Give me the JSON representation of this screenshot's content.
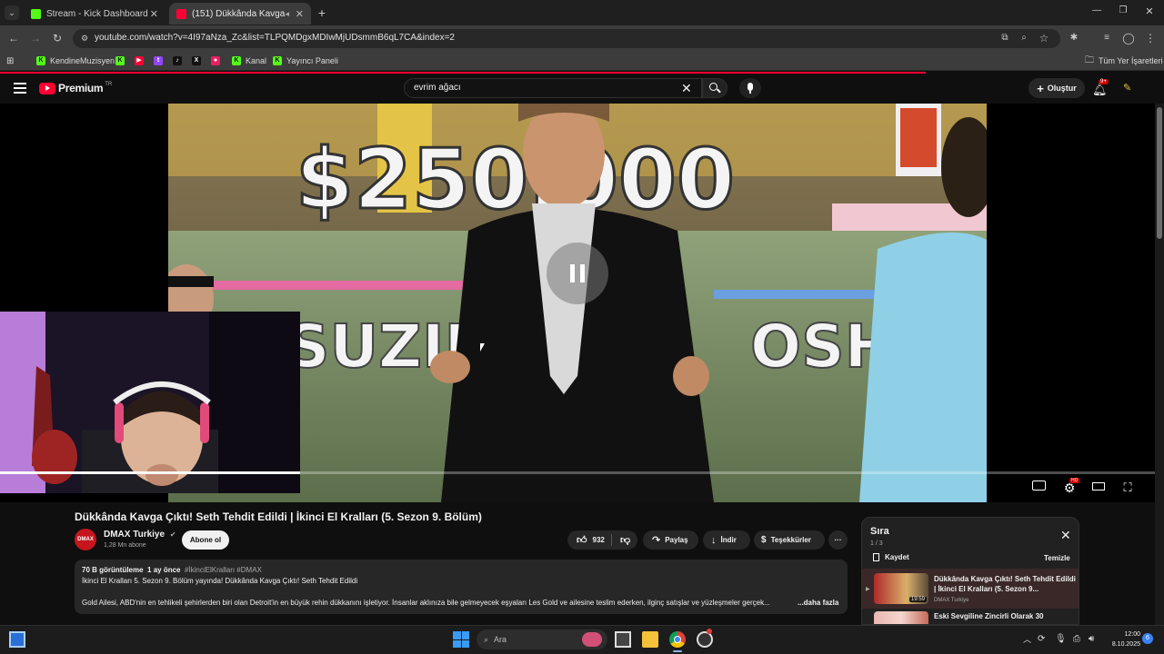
{
  "browser": {
    "tabs": [
      {
        "title": "Stream - Kick Dashboard",
        "favicon_color": "#53fc18"
      },
      {
        "title": "(151) Dükkânda Kavga Çıktı",
        "favicon_color": "#ff0033"
      }
    ],
    "url": "youtube.com/watch?v=4I97aNza_Zc&list=TLPQMDgxMDIwMjUDsmmB6qL7CA&index=2",
    "bookmarks": [
      {
        "label": "KendineMuzisyen",
        "color": "#53fc18",
        "glyph": "K"
      },
      {
        "label": "",
        "color": "#53fc18",
        "glyph": "K"
      },
      {
        "label": "",
        "color": "#ff0033",
        "glyph": "▶"
      },
      {
        "label": "",
        "color": "#9146ff",
        "glyph": "t"
      },
      {
        "label": "",
        "color": "#ffffff",
        "glyph": "♪"
      },
      {
        "label": "",
        "color": "#ffffff",
        "glyph": "X"
      },
      {
        "label": "",
        "color": "#e91e63",
        "glyph": "●"
      },
      {
        "label": "Kanal",
        "color": "#53fc18",
        "glyph": "K"
      },
      {
        "label": "Yayıncı Paneli",
        "color": "#53fc18",
        "glyph": "K"
      }
    ],
    "all_bookmarks_label": "Tüm Yer İşaretleri"
  },
  "yt": {
    "logo_text": "Premium",
    "logo_region": "TR",
    "search_query": "evrim ağacı",
    "create_label": "Oluştur",
    "notif_count": "9+"
  },
  "video": {
    "title": "Dükkânda Kavga Çıktı! Seth Tehdit Edildi | İkinci El Kralları (5. Sezon 9. Bölüm)",
    "overlay_prize": "$250,000",
    "overlay_name_left": "SUZIE",
    "overlay_name_right": "OSH",
    "channel_name": "DMAX Turkiye",
    "channel_avatar_text": "DMAX",
    "subscribers": "1,28 Mn abone",
    "subscribe_label": "Abone ol",
    "likes": "932",
    "share_label": "Paylaş",
    "download_label": "İndir",
    "thanks_label": "Teşekkürler",
    "more_label": "···"
  },
  "description": {
    "views": "70 B görüntüleme",
    "age": "1 ay önce",
    "hashtags": "#İkinciElKralları #DMAX",
    "line1": "İkinci El Kralları 5. Sezon 9. Bölüm yayında! Dükkânda Kavga Çıktı! Seth Tehdit Edildi",
    "line2": "Gold Ailesi, ABD'nin en tehlikeli şehirlerden biri olan Detroit'in en büyük rehin dükkanını işletiyor. İnsanlar aklınıza bile gelmeyecek eşyaları Les Gold ve ailesine teslim ederken, ilginç satışlar ve yüzleşmeler gerçek...",
    "more": "...daha fazla"
  },
  "queue": {
    "title": "Sıra",
    "position": "1 / 3",
    "save_label": "Kaydet",
    "clear_label": "Temizle",
    "items": [
      {
        "title": "Dükkânda Kavga Çıktı! Seth Tehdit Edildi | İkinci El Kralları (5. Sezon 9...",
        "channel": "DMAX Turkiye",
        "duration": "19:59"
      },
      {
        "title": "Eski Sevgiline Zincirli Olarak 30",
        "channel": "",
        "duration": ""
      }
    ]
  },
  "taskbar": {
    "search_placeholder": "Ara",
    "time": "12:00",
    "date": "8.10.2025",
    "notif_count": "6"
  }
}
